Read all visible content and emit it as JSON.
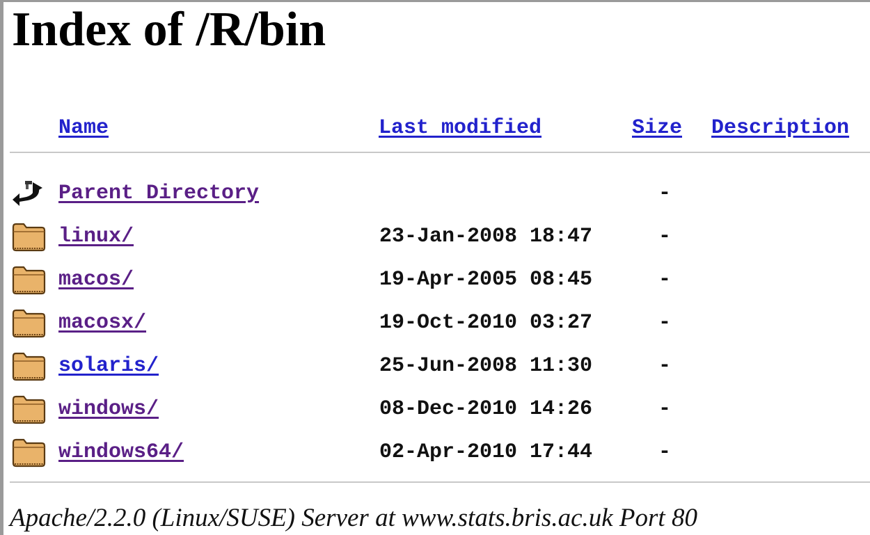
{
  "page": {
    "title": "Index of /R/bin"
  },
  "columns": {
    "name": "Name",
    "last_modified": "Last modified",
    "size": "Size",
    "description": "Description"
  },
  "entries": [
    {
      "icon": "parent-directory-icon",
      "name": "Parent Directory",
      "date": "",
      "size": "-",
      "visited": true
    },
    {
      "icon": "folder-icon",
      "name": "linux/",
      "date": "23-Jan-2008 18:47",
      "size": "-",
      "visited": true
    },
    {
      "icon": "folder-icon",
      "name": "macos/",
      "date": "19-Apr-2005 08:45",
      "size": "-",
      "visited": true
    },
    {
      "icon": "folder-icon",
      "name": "macosx/",
      "date": "19-Oct-2010 03:27",
      "size": "-",
      "visited": true
    },
    {
      "icon": "folder-icon",
      "name": "solaris/",
      "date": "25-Jun-2008 11:30",
      "size": "-",
      "visited": false
    },
    {
      "icon": "folder-icon",
      "name": "windows/",
      "date": "08-Dec-2010 14:26",
      "size": "-",
      "visited": true
    },
    {
      "icon": "folder-icon",
      "name": "windows64/",
      "date": "02-Apr-2010 17:44",
      "size": "-",
      "visited": true
    }
  ],
  "footer": {
    "server_signature": "Apache/2.2.0 (Linux/SUSE) Server at www.stats.bris.ac.uk Port 80"
  },
  "colors": {
    "link": "#2222cc",
    "visited_link": "#5a1f86",
    "folder_fill": "#e9b36a",
    "rule": "#c8c8c8"
  }
}
